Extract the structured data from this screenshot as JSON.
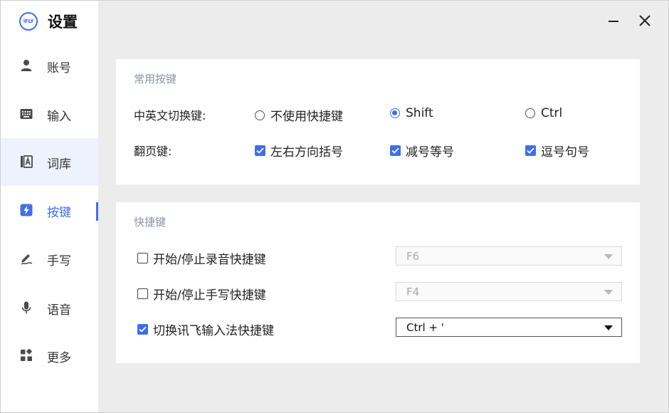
{
  "app": {
    "title": "设置",
    "logo_text": "iFLY"
  },
  "sidebar": {
    "items": [
      {
        "label": "账号",
        "icon": "user-icon"
      },
      {
        "label": "输入",
        "icon": "keyboard-icon"
      },
      {
        "label": "词库",
        "icon": "lexicon-icon"
      },
      {
        "label": "按键",
        "icon": "lightning-icon"
      },
      {
        "label": "手写",
        "icon": "pen-icon"
      },
      {
        "label": "语音",
        "icon": "microphone-icon"
      },
      {
        "label": "更多",
        "icon": "apps-icon"
      }
    ],
    "active_index": 3,
    "hover_index": 2
  },
  "common_keys": {
    "title": "常用按键",
    "switch_label": "中英文切换键:",
    "switch_options": [
      "不使用快捷键",
      "Shift",
      "Ctrl"
    ],
    "switch_selected": "Shift",
    "page_label": "翻页键:",
    "page_options": [
      {
        "label": "左右方向括号",
        "checked": true
      },
      {
        "label": "减号等号",
        "checked": true
      },
      {
        "label": "逗号句号",
        "checked": true
      }
    ]
  },
  "shortcuts": {
    "title": "快捷键",
    "items": [
      {
        "label": "开始/停止录音快捷键",
        "checked": false,
        "value": "F6"
      },
      {
        "label": "开始/停止手写快捷键",
        "checked": false,
        "value": "F4"
      },
      {
        "label": "切换讯飞输入法快捷键",
        "checked": true,
        "value": "Ctrl + '"
      }
    ]
  },
  "colors": {
    "accent": "#3f6ee8",
    "muted": "#8a93a6",
    "background": "#ececec"
  }
}
